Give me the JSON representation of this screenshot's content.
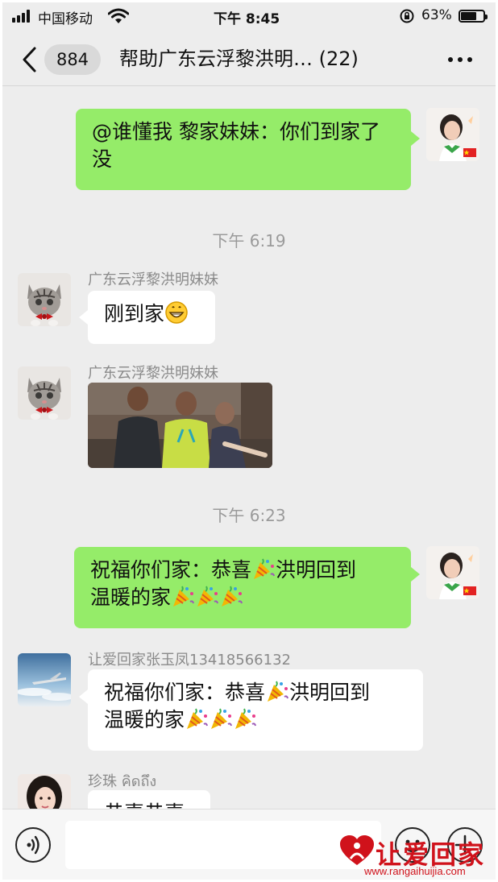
{
  "status_bar": {
    "carrier": "中国移动",
    "time": "下午 8:45",
    "battery_percent": "63%",
    "battery_level": 0.63,
    "icons": [
      "signal-icon",
      "wifi-icon",
      "orientation-lock-icon",
      "battery-icon"
    ]
  },
  "nav": {
    "unread_count": "884",
    "title": "帮助广东云浮黎洪明… (22)",
    "icons": [
      "back-chevron-icon",
      "more-dots-icon"
    ]
  },
  "messages": {
    "m1": {
      "side": "me",
      "text": "@谁懂我 黎家妹妹：你们到家了没"
    },
    "t1": "下午 6:19",
    "m2": {
      "side": "them",
      "sender": "广东云浮黎洪明妹妹",
      "text": "刚到家",
      "emoji": "grinning-face-emoji"
    },
    "m3": {
      "side": "them",
      "sender": "广东云浮黎洪明妹妹",
      "type": "photo"
    },
    "t2": "下午 6:23",
    "m4": {
      "side": "me",
      "line1": "祝福你们家：恭喜",
      "line1b": "洪明回到",
      "line2": "温暖的家",
      "emoji": "party-popper-emoji"
    },
    "m5": {
      "side": "them",
      "sender": "让爱回家张玉凤13418566132",
      "line1": "祝福你们家：恭喜",
      "line1b": "洪明回到",
      "line2": "温暖的家",
      "emoji": "party-popper-emoji"
    },
    "m6": {
      "side": "them",
      "sender": "珍珠 คิดถึง",
      "text": "恭喜恭喜"
    }
  },
  "input_bar": {
    "placeholder": "",
    "icons": [
      "voice-icon",
      "emoji-icon",
      "plus-icon"
    ]
  },
  "watermark": {
    "text": "让爱回家",
    "url": "www.rangaihuijia.com"
  },
  "colors": {
    "my_bubble": "#95ec69",
    "their_bubble": "#ffffff",
    "background": "#ededed",
    "watermark": "#d0121b"
  }
}
